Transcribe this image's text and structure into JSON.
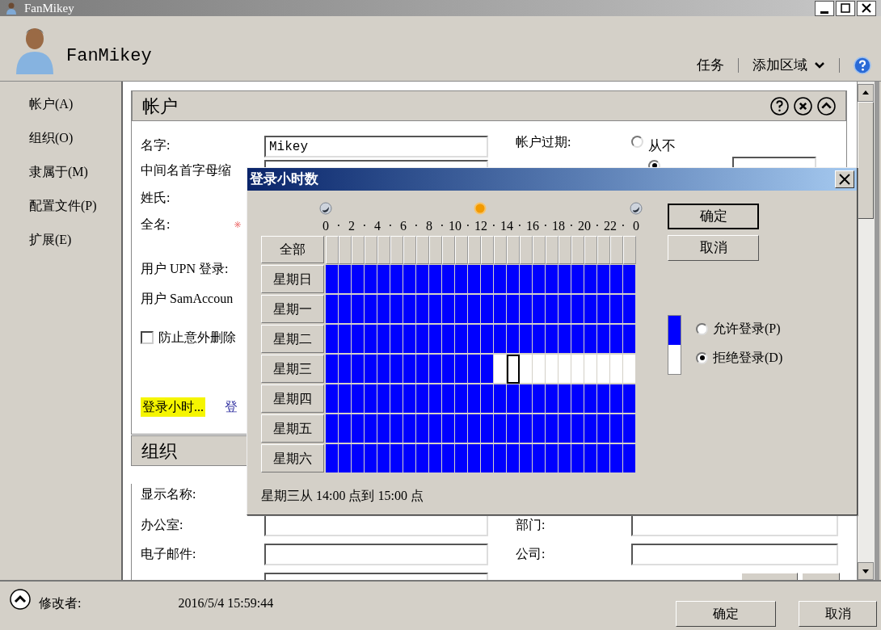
{
  "window": {
    "title": "FanMikey"
  },
  "header": {
    "name": "FanMikey",
    "links": [
      "任务",
      "添加区域"
    ]
  },
  "sidebar": {
    "items": [
      {
        "label": "帐户(A)"
      },
      {
        "label": "组织(O)"
      },
      {
        "label": "隶属于(M)"
      },
      {
        "label": "配置文件(P)"
      },
      {
        "label": "扩展(E)"
      }
    ]
  },
  "account": {
    "title": "帐户",
    "fields": [
      {
        "label": "名字:",
        "kind": "input",
        "value": "Mikey"
      },
      {
        "label": "中间名首字母缩",
        "kind": "input"
      },
      {
        "label": "姓氏:",
        "kind": "plain"
      },
      {
        "label": "全名:",
        "kind": "required"
      },
      {
        "label": "用户 UPN 登录:",
        "kind": "plain"
      },
      {
        "label": "用户 SamAccoun",
        "kind": "plain"
      }
    ],
    "protect": {
      "label": "防止意外删除",
      "checked": false
    },
    "links": [
      {
        "label": "登录小时...",
        "highlighted": true
      },
      {
        "label": "登",
        "highlighted": false
      }
    ],
    "expiry": {
      "label": "帐户过期:",
      "options": [
        {
          "label": "从不",
          "selected": false
        },
        {
          "selected": true
        }
      ]
    }
  },
  "organization": {
    "title": "组织",
    "left": [
      {
        "label": "显示名称:",
        "kind": "plain"
      },
      {
        "label": "办公室:",
        "kind": "input"
      },
      {
        "label": "电子邮件:",
        "kind": "input"
      },
      {
        "kind": "input"
      }
    ],
    "right": [
      {
        "label": "部门:",
        "kind": "input"
      },
      {
        "label": "公司:",
        "kind": "input"
      },
      {
        "kind": "buttons"
      }
    ]
  },
  "footer": {
    "modified_label": "修改者:",
    "modified_value": "2016/5/4 15:59:44",
    "buttons": [
      "确定",
      "取消"
    ]
  },
  "dialog": {
    "title": "登录小时数",
    "scale": [
      "0",
      "·",
      "2",
      "·",
      "4",
      "·",
      "6",
      "·",
      "8",
      "·",
      "10",
      "·",
      "12",
      "·",
      "14",
      "·",
      "16",
      "·",
      "18",
      "·",
      "20",
      "·",
      "22",
      "·",
      "0"
    ],
    "all_label": "全部",
    "days": [
      {
        "label": "星期日",
        "hours": [
          {
            "allowed": true,
            "selected": false
          },
          {
            "allowed": true,
            "selected": false
          },
          {
            "allowed": true,
            "selected": false
          },
          {
            "allowed": true,
            "selected": false
          },
          {
            "allowed": true,
            "selected": false
          },
          {
            "allowed": true,
            "selected": false
          },
          {
            "allowed": true,
            "selected": false
          },
          {
            "allowed": true,
            "selected": false
          },
          {
            "allowed": true,
            "selected": false
          },
          {
            "allowed": true,
            "selected": false
          },
          {
            "allowed": true,
            "selected": false
          },
          {
            "allowed": true,
            "selected": false
          },
          {
            "allowed": true,
            "selected": false
          },
          {
            "allowed": true,
            "selected": false
          },
          {
            "allowed": true,
            "selected": false
          },
          {
            "allowed": true,
            "selected": false
          },
          {
            "allowed": true,
            "selected": false
          },
          {
            "allowed": true,
            "selected": false
          },
          {
            "allowed": true,
            "selected": false
          },
          {
            "allowed": true,
            "selected": false
          },
          {
            "allowed": true,
            "selected": false
          },
          {
            "allowed": true,
            "selected": false
          },
          {
            "allowed": true,
            "selected": false
          },
          {
            "allowed": true,
            "selected": false
          }
        ]
      },
      {
        "label": "星期一",
        "hours": [
          {
            "allowed": true,
            "selected": false
          },
          {
            "allowed": true,
            "selected": false
          },
          {
            "allowed": true,
            "selected": false
          },
          {
            "allowed": true,
            "selected": false
          },
          {
            "allowed": true,
            "selected": false
          },
          {
            "allowed": true,
            "selected": false
          },
          {
            "allowed": true,
            "selected": false
          },
          {
            "allowed": true,
            "selected": false
          },
          {
            "allowed": true,
            "selected": false
          },
          {
            "allowed": true,
            "selected": false
          },
          {
            "allowed": true,
            "selected": false
          },
          {
            "allowed": true,
            "selected": false
          },
          {
            "allowed": true,
            "selected": false
          },
          {
            "allowed": true,
            "selected": false
          },
          {
            "allowed": true,
            "selected": false
          },
          {
            "allowed": true,
            "selected": false
          },
          {
            "allowed": true,
            "selected": false
          },
          {
            "allowed": true,
            "selected": false
          },
          {
            "allowed": true,
            "selected": false
          },
          {
            "allowed": true,
            "selected": false
          },
          {
            "allowed": true,
            "selected": false
          },
          {
            "allowed": true,
            "selected": false
          },
          {
            "allowed": true,
            "selected": false
          },
          {
            "allowed": true,
            "selected": false
          }
        ]
      },
      {
        "label": "星期二",
        "hours": [
          {
            "allowed": true,
            "selected": false
          },
          {
            "allowed": true,
            "selected": false
          },
          {
            "allowed": true,
            "selected": false
          },
          {
            "allowed": true,
            "selected": false
          },
          {
            "allowed": true,
            "selected": false
          },
          {
            "allowed": true,
            "selected": false
          },
          {
            "allowed": true,
            "selected": false
          },
          {
            "allowed": true,
            "selected": false
          },
          {
            "allowed": true,
            "selected": false
          },
          {
            "allowed": true,
            "selected": false
          },
          {
            "allowed": true,
            "selected": false
          },
          {
            "allowed": true,
            "selected": false
          },
          {
            "allowed": true,
            "selected": false
          },
          {
            "allowed": true,
            "selected": false
          },
          {
            "allowed": true,
            "selected": false
          },
          {
            "allowed": true,
            "selected": false
          },
          {
            "allowed": true,
            "selected": false
          },
          {
            "allowed": true,
            "selected": false
          },
          {
            "allowed": true,
            "selected": false
          },
          {
            "allowed": true,
            "selected": false
          },
          {
            "allowed": true,
            "selected": false
          },
          {
            "allowed": true,
            "selected": false
          },
          {
            "allowed": true,
            "selected": false
          },
          {
            "allowed": true,
            "selected": false
          }
        ]
      },
      {
        "label": "星期三",
        "hours": [
          {
            "allowed": true,
            "selected": false
          },
          {
            "allowed": true,
            "selected": false
          },
          {
            "allowed": true,
            "selected": false
          },
          {
            "allowed": true,
            "selected": false
          },
          {
            "allowed": true,
            "selected": false
          },
          {
            "allowed": true,
            "selected": false
          },
          {
            "allowed": true,
            "selected": false
          },
          {
            "allowed": true,
            "selected": false
          },
          {
            "allowed": true,
            "selected": false
          },
          {
            "allowed": true,
            "selected": false
          },
          {
            "allowed": true,
            "selected": false
          },
          {
            "allowed": true,
            "selected": false
          },
          {
            "allowed": true,
            "selected": false
          },
          {
            "allowed": false,
            "selected": false
          },
          {
            "allowed": false,
            "selected": true
          },
          {
            "allowed": false,
            "selected": false
          },
          {
            "allowed": false,
            "selected": false
          },
          {
            "allowed": false,
            "selected": false
          },
          {
            "allowed": false,
            "selected": false
          },
          {
            "allowed": false,
            "selected": false
          },
          {
            "allowed": false,
            "selected": false
          },
          {
            "allowed": false,
            "selected": false
          },
          {
            "allowed": false,
            "selected": false
          },
          {
            "allowed": false,
            "selected": false
          }
        ]
      },
      {
        "label": "星期四",
        "hours": [
          {
            "allowed": true,
            "selected": false
          },
          {
            "allowed": true,
            "selected": false
          },
          {
            "allowed": true,
            "selected": false
          },
          {
            "allowed": true,
            "selected": false
          },
          {
            "allowed": true,
            "selected": false
          },
          {
            "allowed": true,
            "selected": false
          },
          {
            "allowed": true,
            "selected": false
          },
          {
            "allowed": true,
            "selected": false
          },
          {
            "allowed": true,
            "selected": false
          },
          {
            "allowed": true,
            "selected": false
          },
          {
            "allowed": true,
            "selected": false
          },
          {
            "allowed": true,
            "selected": false
          },
          {
            "allowed": true,
            "selected": false
          },
          {
            "allowed": true,
            "selected": false
          },
          {
            "allowed": true,
            "selected": false
          },
          {
            "allowed": true,
            "selected": false
          },
          {
            "allowed": true,
            "selected": false
          },
          {
            "allowed": true,
            "selected": false
          },
          {
            "allowed": true,
            "selected": false
          },
          {
            "allowed": true,
            "selected": false
          },
          {
            "allowed": true,
            "selected": false
          },
          {
            "allowed": true,
            "selected": false
          },
          {
            "allowed": true,
            "selected": false
          },
          {
            "allowed": true,
            "selected": false
          }
        ]
      },
      {
        "label": "星期五",
        "hours": [
          {
            "allowed": true,
            "selected": false
          },
          {
            "allowed": true,
            "selected": false
          },
          {
            "allowed": true,
            "selected": false
          },
          {
            "allowed": true,
            "selected": false
          },
          {
            "allowed": true,
            "selected": false
          },
          {
            "allowed": true,
            "selected": false
          },
          {
            "allowed": true,
            "selected": false
          },
          {
            "allowed": true,
            "selected": false
          },
          {
            "allowed": true,
            "selected": false
          },
          {
            "allowed": true,
            "selected": false
          },
          {
            "allowed": true,
            "selected": false
          },
          {
            "allowed": true,
            "selected": false
          },
          {
            "allowed": true,
            "selected": false
          },
          {
            "allowed": true,
            "selected": false
          },
          {
            "allowed": true,
            "selected": false
          },
          {
            "allowed": true,
            "selected": false
          },
          {
            "allowed": true,
            "selected": false
          },
          {
            "allowed": true,
            "selected": false
          },
          {
            "allowed": true,
            "selected": false
          },
          {
            "allowed": true,
            "selected": false
          },
          {
            "allowed": true,
            "selected": false
          },
          {
            "allowed": true,
            "selected": false
          },
          {
            "allowed": true,
            "selected": false
          },
          {
            "allowed": true,
            "selected": false
          }
        ]
      },
      {
        "label": "星期六",
        "hours": [
          {
            "allowed": true,
            "selected": false
          },
          {
            "allowed": true,
            "selected": false
          },
          {
            "allowed": true,
            "selected": false
          },
          {
            "allowed": true,
            "selected": false
          },
          {
            "allowed": true,
            "selected": false
          },
          {
            "allowed": true,
            "selected": false
          },
          {
            "allowed": true,
            "selected": false
          },
          {
            "allowed": true,
            "selected": false
          },
          {
            "allowed": true,
            "selected": false
          },
          {
            "allowed": true,
            "selected": false
          },
          {
            "allowed": true,
            "selected": false
          },
          {
            "allowed": true,
            "selected": false
          },
          {
            "allowed": true,
            "selected": false
          },
          {
            "allowed": true,
            "selected": false
          },
          {
            "allowed": true,
            "selected": false
          },
          {
            "allowed": true,
            "selected": false
          },
          {
            "allowed": true,
            "selected": false
          },
          {
            "allowed": true,
            "selected": false
          },
          {
            "allowed": true,
            "selected": false
          },
          {
            "allowed": true,
            "selected": false
          },
          {
            "allowed": true,
            "selected": false
          },
          {
            "allowed": true,
            "selected": false
          },
          {
            "allowed": true,
            "selected": false
          },
          {
            "allowed": true,
            "selected": false
          }
        ]
      }
    ],
    "status": "星期三从 14:00 点到 15:00 点",
    "buttons": [
      "确定",
      "取消"
    ],
    "options": [
      {
        "label": "允许登录(P)",
        "kind": "allow",
        "selected": false
      },
      {
        "label": "拒绝登录(D)",
        "kind": "deny",
        "selected": true
      }
    ]
  }
}
